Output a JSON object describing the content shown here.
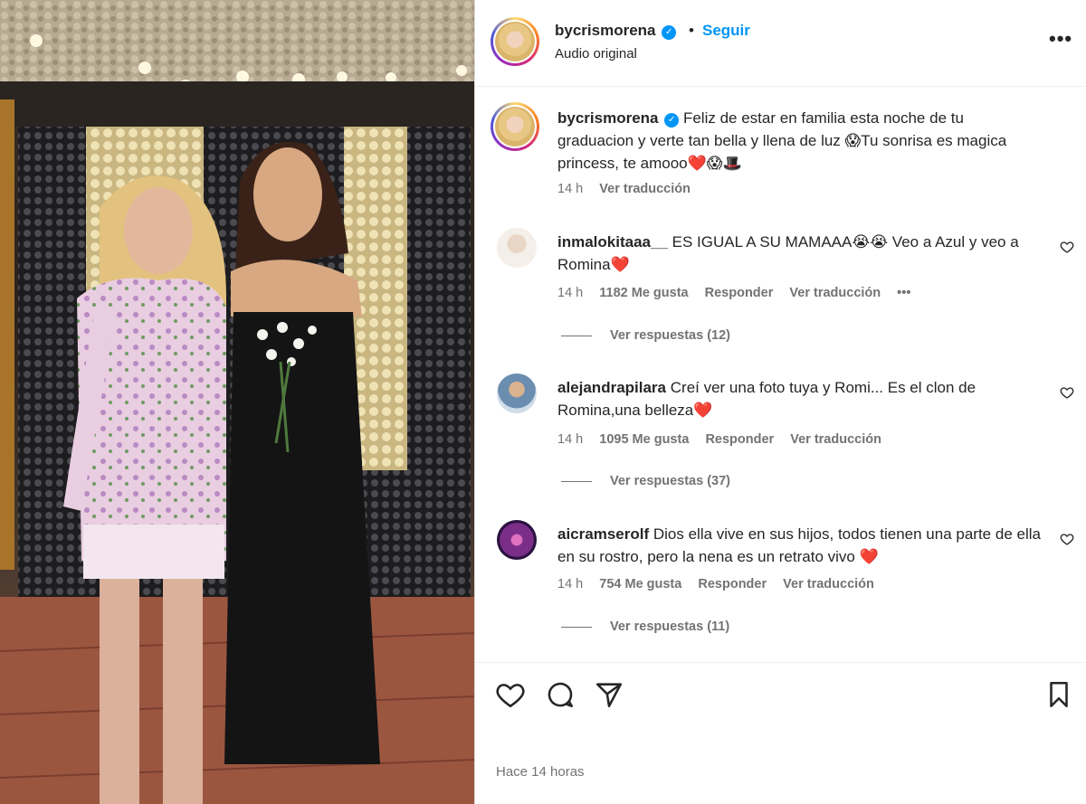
{
  "post": {
    "username": "bycrismorena",
    "follow_label": "Seguir",
    "dot": "•",
    "subtitle": "Audio original",
    "more": "•••"
  },
  "caption": {
    "username": "bycrismorena",
    "text": "Feliz de estar en familia esta noche de tu graduacion y verte tan bella y llena de luz 😱Tu sonrisa es magica princess, te amooo❤️😱🎩",
    "time": "14 h",
    "translate": "Ver traducción"
  },
  "comments": [
    {
      "username": "inmalokitaaa__",
      "text": "ES IGUAL A SU MAMAAA😭😭 Veo a Azul y veo a Romina❤️",
      "time": "14 h",
      "likes": "1182 Me gusta",
      "reply": "Responder",
      "translate": "Ver traducción",
      "options": "•••",
      "replies": "Ver respuestas (12)"
    },
    {
      "username": "alejandrapilara",
      "text": "Creí ver una foto tuya y Romi... Es el clon de Romina,una belleza❤️",
      "time": "14 h",
      "likes": "1095 Me gusta",
      "reply": "Responder",
      "translate": "Ver traducción",
      "replies": "Ver respuestas (37)"
    },
    {
      "username": "aicramserolf",
      "text": "Dios ella vive en sus hijos, todos tienen una parte de ella en su rostro, pero la nena es un retrato vivo ❤️",
      "time": "14 h",
      "likes": "754 Me gusta",
      "reply": "Responder",
      "translate": "Ver traducción",
      "replies": "Ver respuestas (11)"
    }
  ],
  "footer": {
    "timestamp": "Hace 14 horas"
  },
  "colors": {
    "accent": "#0095f6",
    "text": "#262626",
    "secondary": "#737373"
  },
  "icons": [
    "verified-badge-icon",
    "more-options-icon",
    "heart-icon",
    "comment-icon",
    "share-icon",
    "bookmark-icon"
  ]
}
